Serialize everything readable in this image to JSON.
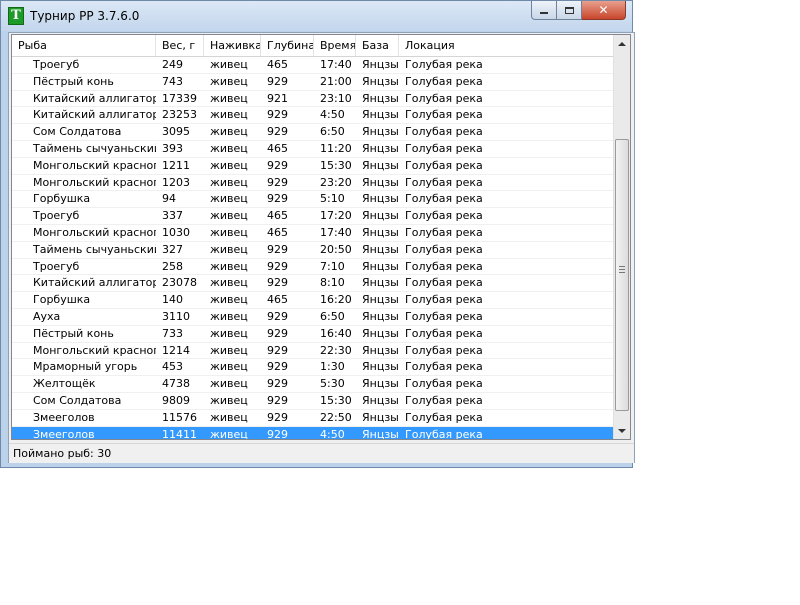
{
  "window": {
    "title": "Турнир РР 3.7.6.0",
    "icon_letter": "T"
  },
  "columns": [
    "Рыба",
    "Вес, г",
    "Наживка",
    "Глубина",
    "Время",
    "База",
    "Локация"
  ],
  "rows": [
    [
      "Троегуб",
      "249",
      "живец",
      "465",
      "17:40",
      "Янцзы",
      "Голубая река"
    ],
    [
      "Пёстрый конь",
      "743",
      "живец",
      "929",
      "21:00",
      "Янцзы",
      "Голубая река"
    ],
    [
      "Китайский аллигатор",
      "17339",
      "живец",
      "921",
      "23:10",
      "Янцзы",
      "Голубая река"
    ],
    [
      "Китайский аллигатор",
      "23253",
      "живец",
      "929",
      "4:50",
      "Янцзы",
      "Голубая река"
    ],
    [
      "Сом Солдатова",
      "3095",
      "живец",
      "929",
      "6:50",
      "Янцзы",
      "Голубая река"
    ],
    [
      "Таймень сычуаньский",
      "393",
      "живец",
      "465",
      "11:20",
      "Янцзы",
      "Голубая река"
    ],
    [
      "Монгольский краснопёр",
      "1211",
      "живец",
      "929",
      "15:30",
      "Янцзы",
      "Голубая река"
    ],
    [
      "Монгольский краснопёр",
      "1203",
      "живец",
      "929",
      "23:20",
      "Янцзы",
      "Голубая река"
    ],
    [
      "Горбушка",
      "94",
      "живец",
      "929",
      "5:10",
      "Янцзы",
      "Голубая река"
    ],
    [
      "Троегуб",
      "337",
      "живец",
      "465",
      "17:20",
      "Янцзы",
      "Голубая река"
    ],
    [
      "Монгольский краснопёр",
      "1030",
      "живец",
      "465",
      "17:40",
      "Янцзы",
      "Голубая река"
    ],
    [
      "Таймень сычуаньский",
      "327",
      "живец",
      "929",
      "20:50",
      "Янцзы",
      "Голубая река"
    ],
    [
      "Троегуб",
      "258",
      "живец",
      "929",
      "7:10",
      "Янцзы",
      "Голубая река"
    ],
    [
      "Китайский аллигатор",
      "23078",
      "живец",
      "929",
      "8:10",
      "Янцзы",
      "Голубая река"
    ],
    [
      "Горбушка",
      "140",
      "живец",
      "465",
      "16:20",
      "Янцзы",
      "Голубая река"
    ],
    [
      "Ауха",
      "3110",
      "живец",
      "929",
      "6:50",
      "Янцзы",
      "Голубая река"
    ],
    [
      "Пёстрый конь",
      "733",
      "живец",
      "929",
      "16:40",
      "Янцзы",
      "Голубая река"
    ],
    [
      "Монгольский краснопёр",
      "1214",
      "живец",
      "929",
      "22:30",
      "Янцзы",
      "Голубая река"
    ],
    [
      "Мраморный угорь",
      "453",
      "живец",
      "929",
      "1:30",
      "Янцзы",
      "Голубая река"
    ],
    [
      "Желтощёк",
      "4738",
      "живец",
      "929",
      "5:30",
      "Янцзы",
      "Голубая река"
    ],
    [
      "Сом Солдатова",
      "9809",
      "живец",
      "929",
      "15:30",
      "Янцзы",
      "Голубая река"
    ],
    [
      "Змееголов",
      "11576",
      "живец",
      "929",
      "22:50",
      "Янцзы",
      "Голубая река"
    ],
    [
      "Змееголов",
      "11411",
      "живец",
      "929",
      "4:50",
      "Янцзы",
      "Голубая река"
    ]
  ],
  "selected_row": 22,
  "status": {
    "text": "Поймано рыб: 30"
  },
  "colors": {
    "selection": "#3399ff",
    "title_bar": "#c3d6ec",
    "close_button": "#c8452b"
  },
  "icons": [
    "minimize-icon",
    "maximize-icon",
    "close-icon",
    "scroll-up-icon",
    "scroll-down-icon"
  ]
}
